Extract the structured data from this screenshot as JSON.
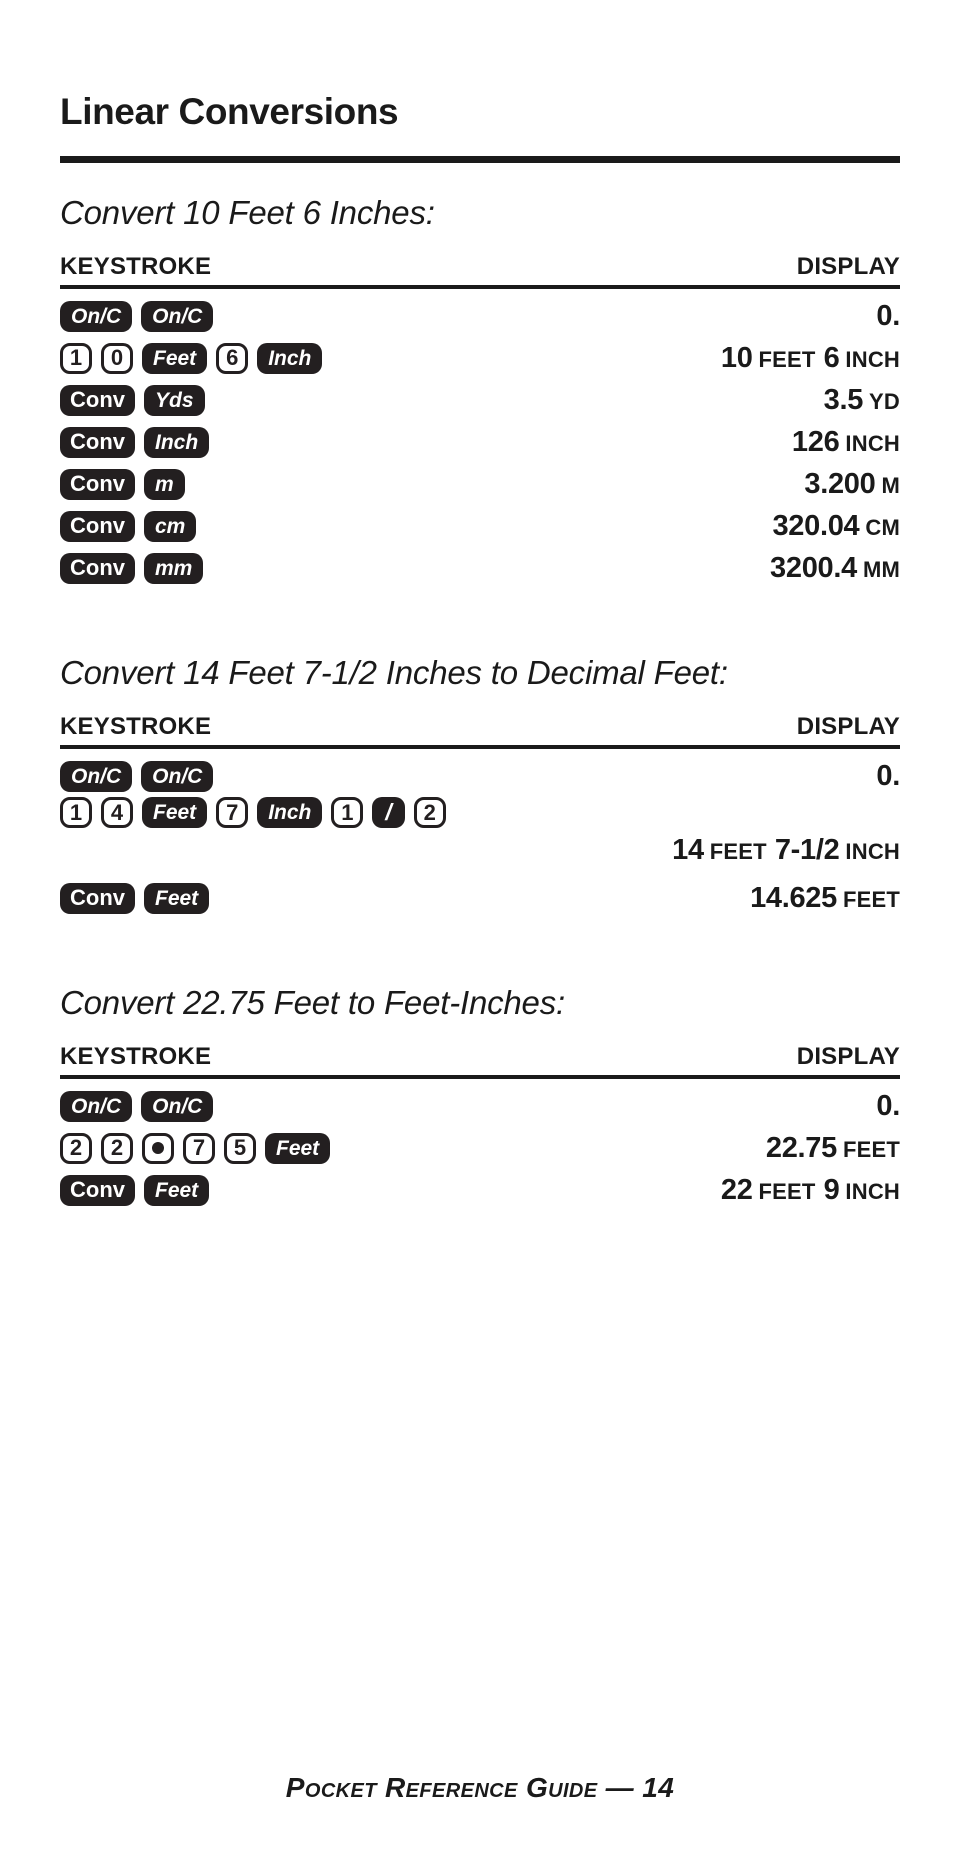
{
  "page": {
    "title": "Linear Conversions",
    "footer": "Pocket Reference Guide — 14"
  },
  "table_headers": {
    "keystroke": "KEYSTROKE",
    "display": "DISPLAY"
  },
  "sections": [
    {
      "heading": "Convert 10 Feet 6 Inches:",
      "rows": [
        {
          "keys": [
            {
              "label": "On/C",
              "type": "fn"
            },
            {
              "label": "On/C",
              "type": "fn"
            }
          ],
          "display": [
            {
              "text": "0.",
              "kind": "num"
            }
          ]
        },
        {
          "keys": [
            {
              "label": "1",
              "type": "num"
            },
            {
              "label": "0",
              "type": "num"
            },
            {
              "label": "Feet",
              "type": "fn"
            },
            {
              "label": "6",
              "type": "num"
            },
            {
              "label": "Inch",
              "type": "fn"
            }
          ],
          "display": [
            {
              "text": "10",
              "kind": "num"
            },
            {
              "text": "FEET",
              "kind": "unit"
            },
            {
              "text": "6",
              "kind": "num"
            },
            {
              "text": "INCH",
              "kind": "unit"
            }
          ]
        },
        {
          "keys": [
            {
              "label": "Conv",
              "type": "fn-upright"
            },
            {
              "label": "Yds",
              "type": "fn"
            }
          ],
          "display": [
            {
              "text": "3.5",
              "kind": "num"
            },
            {
              "text": "YD",
              "kind": "unit"
            }
          ]
        },
        {
          "keys": [
            {
              "label": "Conv",
              "type": "fn-upright"
            },
            {
              "label": "Inch",
              "type": "fn"
            }
          ],
          "display": [
            {
              "text": "126",
              "kind": "num"
            },
            {
              "text": "INCH",
              "kind": "unit"
            }
          ]
        },
        {
          "keys": [
            {
              "label": "Conv",
              "type": "fn-upright"
            },
            {
              "label": "m",
              "type": "fn"
            }
          ],
          "display": [
            {
              "text": "3.200",
              "kind": "num"
            },
            {
              "text": "M",
              "kind": "unit"
            }
          ]
        },
        {
          "keys": [
            {
              "label": "Conv",
              "type": "fn-upright"
            },
            {
              "label": "cm",
              "type": "fn"
            }
          ],
          "display": [
            {
              "text": "320.04",
              "kind": "num"
            },
            {
              "text": "CM",
              "kind": "unit"
            }
          ]
        },
        {
          "keys": [
            {
              "label": "Conv",
              "type": "fn-upright"
            },
            {
              "label": "mm",
              "type": "fn"
            }
          ],
          "display": [
            {
              "text": "3200.4",
              "kind": "num"
            },
            {
              "text": "MM",
              "kind": "unit"
            }
          ]
        }
      ]
    },
    {
      "heading": "Convert 14 Feet 7-1/2 Inches to Decimal Feet:",
      "rows": [
        {
          "keys": [
            {
              "label": "On/C",
              "type": "fn"
            },
            {
              "label": "On/C",
              "type": "fn"
            }
          ],
          "display": [
            {
              "text": "0.",
              "kind": "num"
            }
          ]
        },
        {
          "wrapped": true,
          "keys": [
            {
              "label": "1",
              "type": "num"
            },
            {
              "label": "4",
              "type": "num"
            },
            {
              "label": "Feet",
              "type": "fn"
            },
            {
              "label": "7",
              "type": "num"
            },
            {
              "label": "Inch",
              "type": "fn"
            },
            {
              "label": "1",
              "type": "num"
            },
            {
              "label": "/",
              "type": "fn-slash"
            },
            {
              "label": "2",
              "type": "num"
            }
          ],
          "display": [
            {
              "text": "14",
              "kind": "num"
            },
            {
              "text": "FEET",
              "kind": "unit"
            },
            {
              "text": "7-1/2",
              "kind": "num"
            },
            {
              "text": "INCH",
              "kind": "unit"
            }
          ]
        },
        {
          "keys": [
            {
              "label": "Conv",
              "type": "fn-upright"
            },
            {
              "label": "Feet",
              "type": "fn"
            }
          ],
          "display": [
            {
              "text": "14.625",
              "kind": "num"
            },
            {
              "text": "FEET",
              "kind": "unit"
            }
          ]
        }
      ]
    },
    {
      "heading": "Convert 22.75 Feet to Feet-Inches:",
      "rows": [
        {
          "keys": [
            {
              "label": "On/C",
              "type": "fn"
            },
            {
              "label": "On/C",
              "type": "fn"
            }
          ],
          "display": [
            {
              "text": "0.",
              "kind": "num"
            }
          ]
        },
        {
          "keys": [
            {
              "label": "2",
              "type": "num"
            },
            {
              "label": "2",
              "type": "num"
            },
            {
              "label": "•",
              "type": "num-dot"
            },
            {
              "label": "7",
              "type": "num"
            },
            {
              "label": "5",
              "type": "num"
            },
            {
              "label": "Feet",
              "type": "fn"
            }
          ],
          "display": [
            {
              "text": "22.75",
              "kind": "num"
            },
            {
              "text": "FEET",
              "kind": "unit"
            }
          ]
        },
        {
          "keys": [
            {
              "label": "Conv",
              "type": "fn-upright"
            },
            {
              "label": "Feet",
              "type": "fn"
            }
          ],
          "display": [
            {
              "text": "22",
              "kind": "num"
            },
            {
              "text": "FEET",
              "kind": "unit"
            },
            {
              "text": "9",
              "kind": "num"
            },
            {
              "text": "INCH",
              "kind": "unit"
            }
          ]
        }
      ]
    }
  ]
}
